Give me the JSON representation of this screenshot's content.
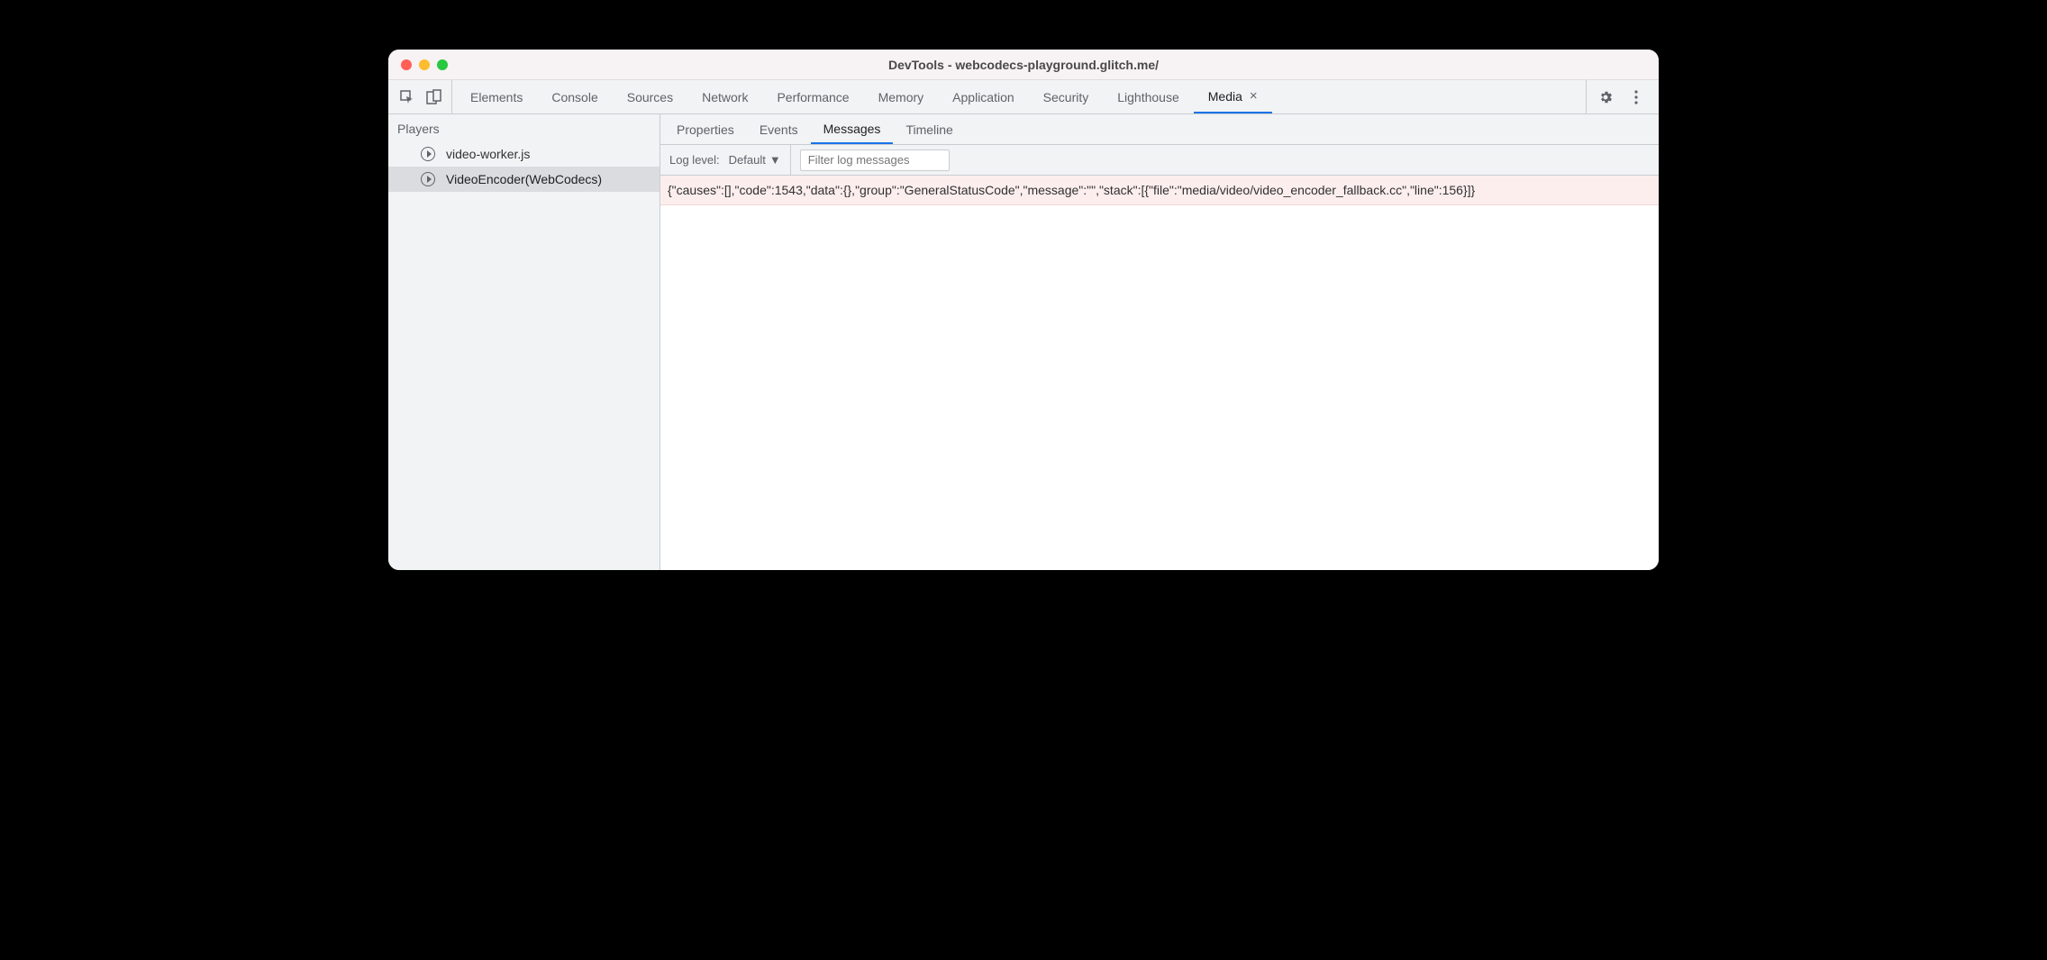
{
  "window": {
    "title": "DevTools - webcodecs-playground.glitch.me/"
  },
  "tabs": [
    {
      "label": "Elements",
      "active": false
    },
    {
      "label": "Console",
      "active": false
    },
    {
      "label": "Sources",
      "active": false
    },
    {
      "label": "Network",
      "active": false
    },
    {
      "label": "Performance",
      "active": false
    },
    {
      "label": "Memory",
      "active": false
    },
    {
      "label": "Application",
      "active": false
    },
    {
      "label": "Security",
      "active": false
    },
    {
      "label": "Lighthouse",
      "active": false
    },
    {
      "label": "Media",
      "active": true,
      "closable": true
    }
  ],
  "sidebar": {
    "header": "Players",
    "items": [
      {
        "label": "video-worker.js",
        "selected": false
      },
      {
        "label": "VideoEncoder(WebCodecs)",
        "selected": true
      }
    ]
  },
  "subtabs": [
    {
      "label": "Properties",
      "active": false
    },
    {
      "label": "Events",
      "active": false
    },
    {
      "label": "Messages",
      "active": true
    },
    {
      "label": "Timeline",
      "active": false
    }
  ],
  "filterbar": {
    "loglevel_label": "Log level:",
    "loglevel_value": "Default",
    "filter_placeholder": "Filter log messages"
  },
  "messages": [
    {
      "text": "{\"causes\":[],\"code\":1543,\"data\":{},\"group\":\"GeneralStatusCode\",\"message\":\"\",\"stack\":[{\"file\":\"media/video/video_encoder_fallback.cc\",\"line\":156}]}"
    }
  ]
}
